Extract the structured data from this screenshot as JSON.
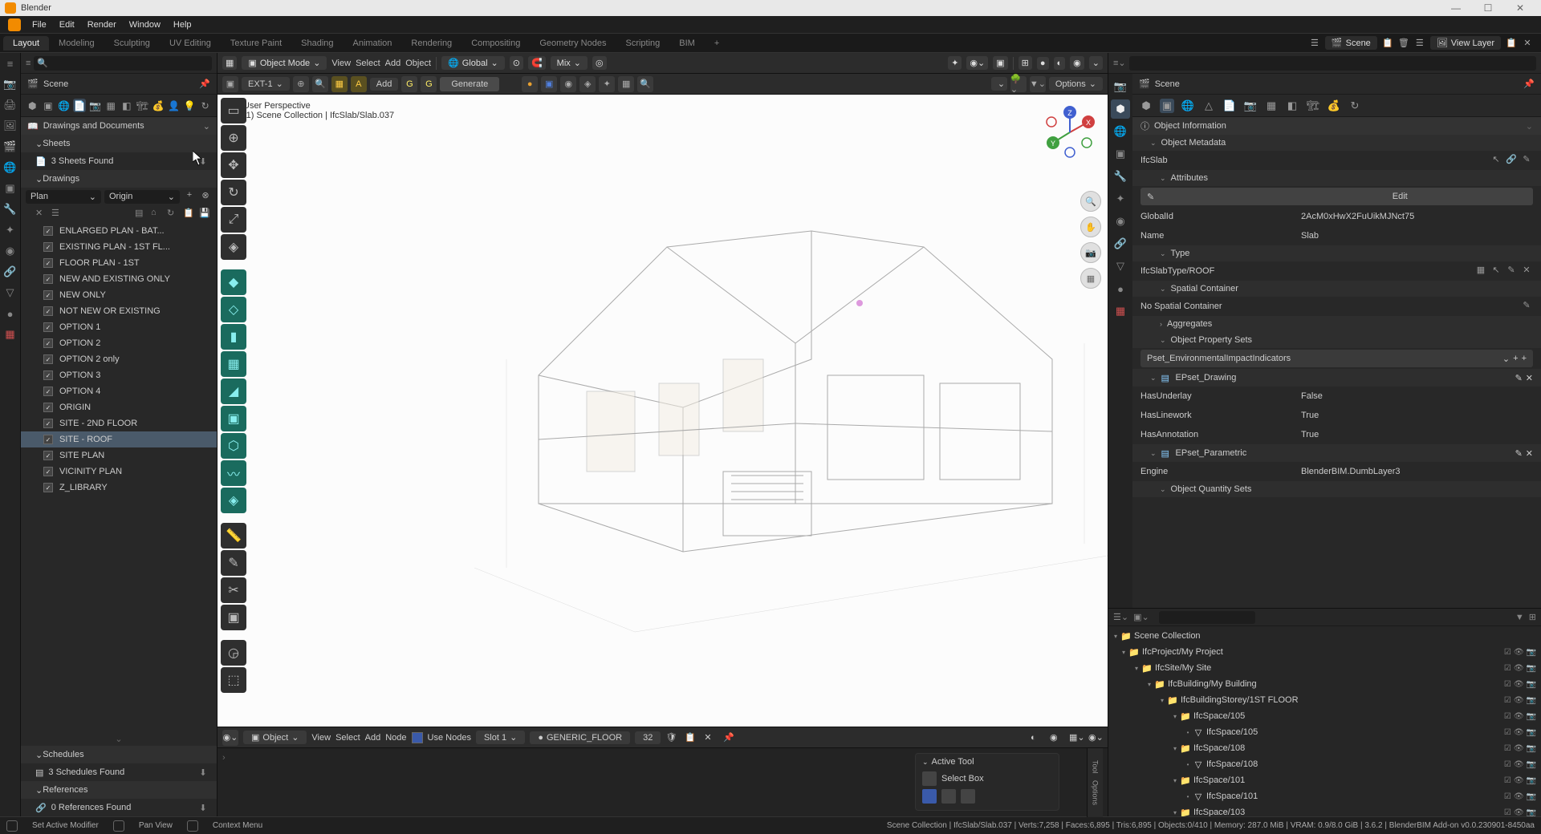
{
  "app": {
    "title": "Blender"
  },
  "menubar": [
    "File",
    "Edit",
    "Render",
    "Window",
    "Help"
  ],
  "tabs": {
    "active": "Layout",
    "items": [
      "Layout",
      "Modeling",
      "Sculpting",
      "UV Editing",
      "Texture Paint",
      "Shading",
      "Animation",
      "Rendering",
      "Compositing",
      "Geometry Nodes",
      "Scripting",
      "BIM"
    ]
  },
  "topright": {
    "scene": "Scene",
    "viewlayer": "View Layer"
  },
  "left": {
    "scene_label": "Scene",
    "dropdown": "Drawings and Documents",
    "sheets": {
      "header": "Sheets",
      "found": "3 Sheets Found"
    },
    "drawings": {
      "header": "Drawings",
      "type": "Plan",
      "origin": "Origin",
      "list": [
        "ENLARGED PLAN - BAT...",
        "EXISTING PLAN - 1ST FL...",
        "FLOOR PLAN - 1ST",
        "NEW AND EXISTING ONLY",
        "NEW ONLY",
        "NOT NEW OR EXISTING",
        "OPTION 1",
        "OPTION 2",
        "OPTION 2 only",
        "OPTION 3",
        "OPTION 4",
        "ORIGIN",
        "SITE - 2ND FLOOR",
        "SITE - ROOF",
        "SITE PLAN",
        "VICINITY PLAN",
        "Z_LIBRARY"
      ],
      "selected_index": 13
    },
    "schedules": {
      "header": "Schedules",
      "found": "3 Schedules Found"
    },
    "references": {
      "header": "References",
      "found": "0 References Found"
    }
  },
  "viewport": {
    "mode": "Object Mode",
    "menus": [
      "View",
      "Select",
      "Add",
      "Object"
    ],
    "orient": "Global",
    "snap": "Mix",
    "ext": "EXT-1",
    "add": "Add",
    "generate": "Generate",
    "options": "Options",
    "persp": "User Perspective",
    "collection": "(1)  Scene Collection | IfcSlab/Slab.037",
    "bottom": {
      "object": "Object",
      "menus": [
        "View",
        "Select",
        "Add",
        "Node"
      ],
      "usenodes": "Use Nodes",
      "slot": "Slot 1",
      "material": "GENERIC_FLOOR",
      "count": "32"
    },
    "activetool": {
      "title": "Active Tool",
      "tool": "Select Box"
    },
    "vtabs": [
      "Tool",
      "Options"
    ]
  },
  "right": {
    "scene_label": "Scene",
    "objinfo": "Object Information",
    "metadata": "Object Metadata",
    "classname": "IfcSlab",
    "attributes": "Attributes",
    "edit": "Edit",
    "globalid": {
      "label": "GlobalId",
      "value": "2AcM0xHwX2FuUikMJNct75"
    },
    "name": {
      "label": "Name",
      "value": "Slab"
    },
    "typehdr": "Type",
    "typeval": "IfcSlabType/ROOF",
    "spatial": "Spatial Container",
    "nospatial": "No Spatial Container",
    "aggregates": "Aggregates",
    "opsets": "Object Property Sets",
    "pset_drop": "Pset_EnvironmentalImpactIndicators",
    "epset_drawing": {
      "title": "EPset_Drawing",
      "props": [
        {
          "label": "HasUnderlay",
          "value": "False"
        },
        {
          "label": "HasLinework",
          "value": "True"
        },
        {
          "label": "HasAnnotation",
          "value": "True"
        }
      ]
    },
    "epset_param": {
      "title": "EPset_Parametric",
      "engine": {
        "label": "Engine",
        "value": "BlenderBIM.DumbLayer3"
      }
    },
    "oqsets": "Object Quantity Sets"
  },
  "outliner": {
    "root": "Scene Collection",
    "tree": [
      {
        "depth": 0,
        "icon": "col",
        "label": "IfcProject/My Project"
      },
      {
        "depth": 1,
        "icon": "col",
        "label": "IfcSite/My Site"
      },
      {
        "depth": 2,
        "icon": "col",
        "label": "IfcBuilding/My Building"
      },
      {
        "depth": 3,
        "icon": "col",
        "label": "IfcBuildingStorey/1ST FLOOR"
      },
      {
        "depth": 4,
        "icon": "col",
        "label": "IfcSpace/105"
      },
      {
        "depth": 5,
        "icon": "mesh",
        "label": "IfcSpace/105"
      },
      {
        "depth": 4,
        "icon": "col",
        "label": "IfcSpace/108"
      },
      {
        "depth": 5,
        "icon": "mesh",
        "label": "IfcSpace/108"
      },
      {
        "depth": 4,
        "icon": "col",
        "label": "IfcSpace/101"
      },
      {
        "depth": 5,
        "icon": "mesh",
        "label": "IfcSpace/101"
      },
      {
        "depth": 4,
        "icon": "col",
        "label": "IfcSpace/103"
      }
    ]
  },
  "status": {
    "left1": "Set Active Modifier",
    "left2": "Pan View",
    "left3": "Context Menu",
    "right": "Scene Collection | IfcSlab/Slab.037  |  Verts:7,258  |  Faces:6,895  |  Tris:6,895  |  Objects:0/410  |  Memory: 287.0 MiB  |  VRAM: 0.9/8.0 GiB  |  3.6.2  |  BlenderBIM Add-on v0.0.230901-8450aa"
  }
}
